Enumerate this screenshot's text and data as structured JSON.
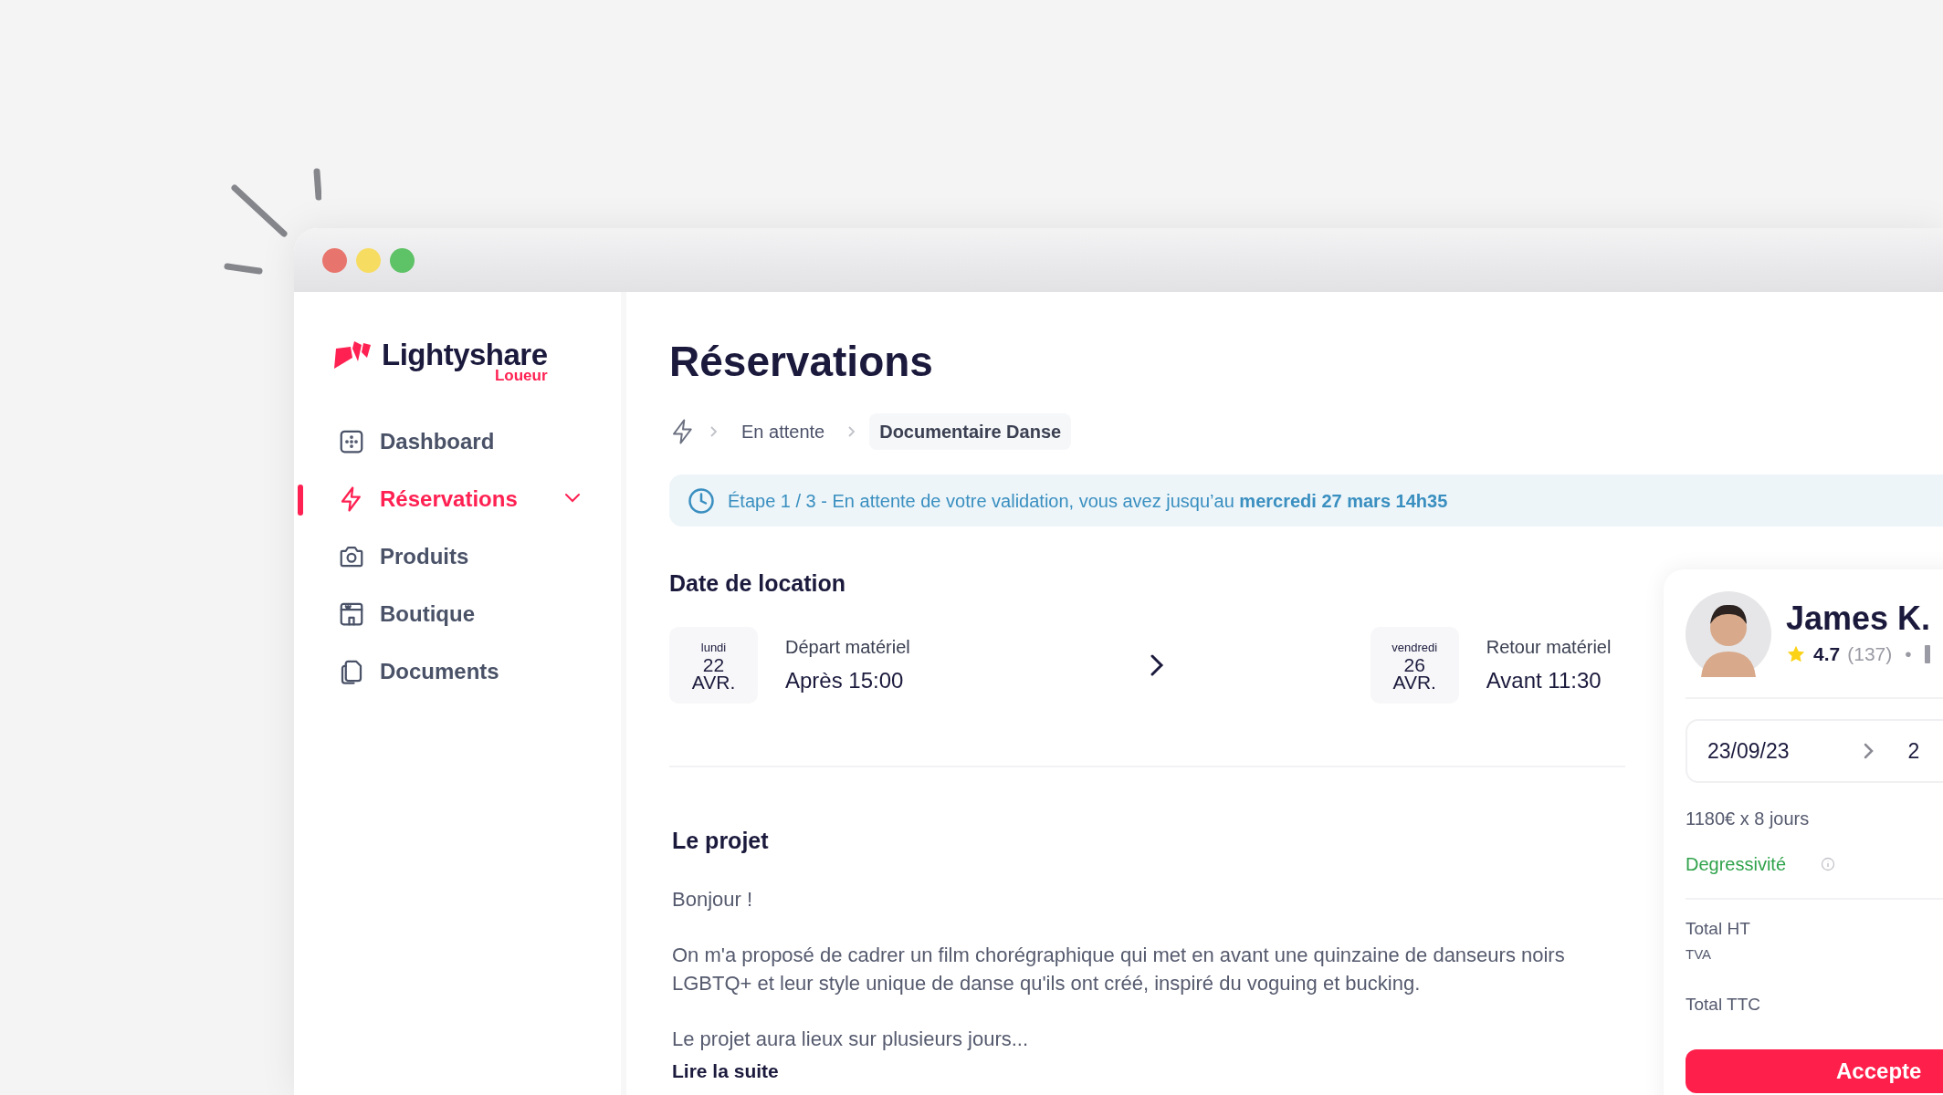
{
  "sidebar": {
    "logo": {
      "name": "Lightyshare",
      "subtitle": "Loueur"
    },
    "items": [
      {
        "label": "Dashboard",
        "selected": false,
        "kind": "link"
      },
      {
        "label": "Réservations",
        "selected": true,
        "kind": "group",
        "expanded": false
      },
      {
        "label": "Produits",
        "selected": false,
        "kind": "link"
      },
      {
        "label": "Boutique",
        "selected": false,
        "kind": "link"
      },
      {
        "label": "Documents",
        "selected": false,
        "kind": "link"
      }
    ]
  },
  "page": {
    "title": "Réservations",
    "breadcrumb": [
      {
        "label": "En attente",
        "selected": false
      },
      {
        "label": "Documentaire Danse",
        "selected": true
      }
    ],
    "banner": "Étape 1 / 3 - En attente de votre validation, vous avez jusqu’au **mercredi 27 mars 14h35**"
  },
  "rental_dates": {
    "title": "Date de location",
    "start": {
      "weekday": "lundi",
      "day": "22",
      "month": "AVR.",
      "label": "Départ matériel",
      "time": "Après 15:00"
    },
    "end": {
      "weekday": "vendredi",
      "day": "26",
      "month": "AVR.",
      "label": "Retour matériel",
      "time": "Avant 11:30"
    }
  },
  "project": {
    "title": "Le projet",
    "paragraphs": [
      "Bonjour !",
      "On m'a proposé de cadrer un film chorégraphique qui met en avant une quinzaine de danseurs noirs LGBTQ+ et leur style unique de danse qu'ils ont créé, inspiré du voguing et bucking.",
      "Le projet aura lieux sur plusieurs jours..."
    ],
    "read_more": "Lire la suite"
  },
  "owner": {
    "name": "James K.",
    "rating": "4.7",
    "reviews": "(137)",
    "separator": "•"
  },
  "booking": {
    "start_date": "23/09/23",
    "end_date": "2",
    "price_line": "1180€ x 8 jours",
    "discount": "Degressivité",
    "total_ht": "Total HT",
    "tva": "TVA",
    "total_ttc": "Total TTC",
    "accept": "Accepte"
  }
}
